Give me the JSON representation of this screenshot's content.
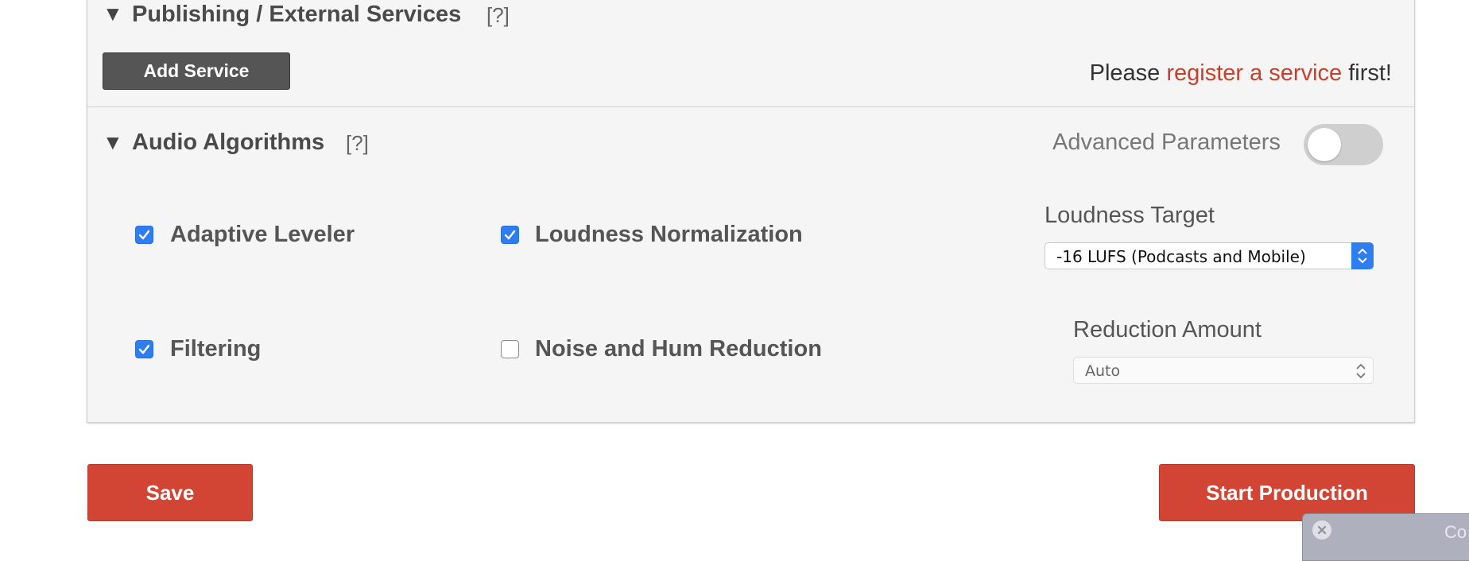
{
  "publishing": {
    "title": "Publishing / External Services",
    "help": "[?]",
    "add_button": "Add Service",
    "register_prefix": "Please ",
    "register_link": "register a service",
    "register_suffix": " first!"
  },
  "audio": {
    "title": "Audio Algorithms",
    "help": "[?]",
    "advanced_label": "Advanced Parameters",
    "advanced_enabled": false,
    "options": [
      {
        "label": "Adaptive Leveler",
        "checked": true
      },
      {
        "label": "Loudness Normalization",
        "checked": true
      },
      {
        "label": "Filtering",
        "checked": true
      },
      {
        "label": "Noise and Hum Reduction",
        "checked": false
      }
    ],
    "loudness_target": {
      "label": "Loudness Target",
      "value": "-16 LUFS (Podcasts and Mobile)"
    },
    "reduction_amount": {
      "label": "Reduction Amount",
      "value": "Auto"
    }
  },
  "actions": {
    "save": "Save",
    "start": "Start Production"
  },
  "popup": {
    "text": "Co"
  },
  "colors": {
    "accent_red": "#d24535",
    "link_red": "#c7402d",
    "checkbox_blue": "#2e7ef2"
  }
}
